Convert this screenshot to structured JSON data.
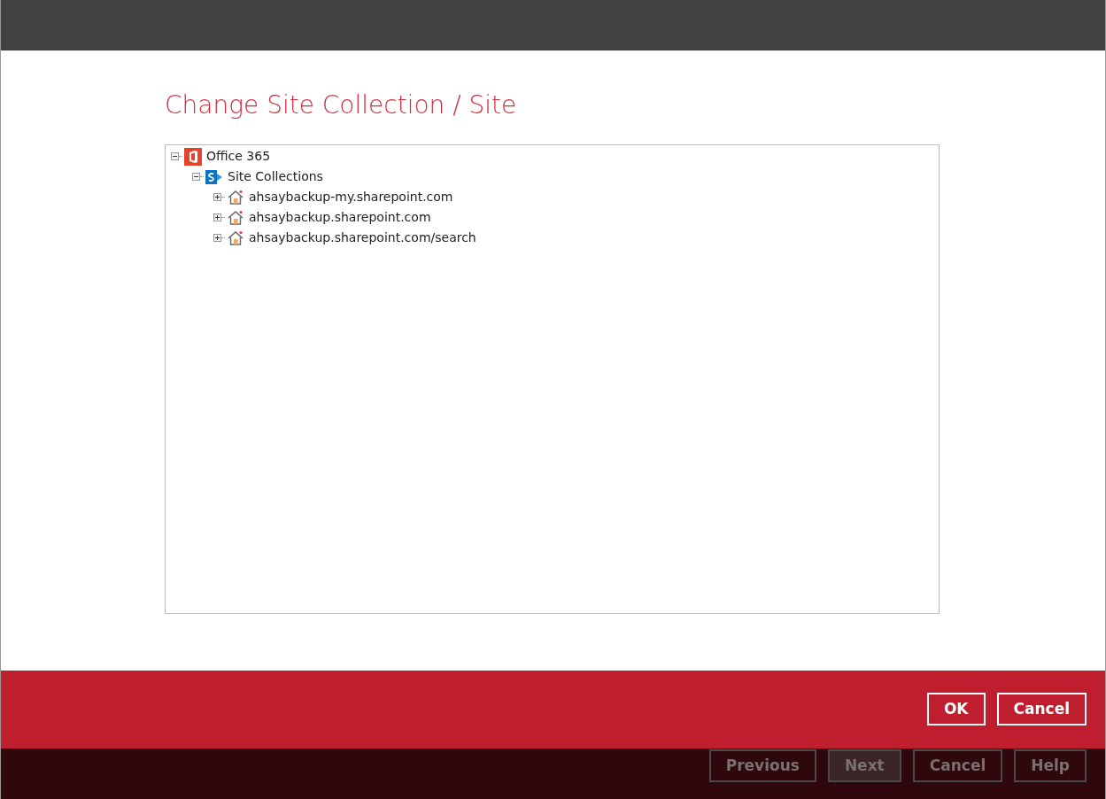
{
  "dialog": {
    "title": "Change Site Collection / Site"
  },
  "tree": [
    {
      "label": "Office 365",
      "kind": "office",
      "expanded": true,
      "children": [
        {
          "label": "Site Collections",
          "kind": "sharepoint",
          "expanded": true,
          "children": [
            {
              "label": "ahsaybackup-my.sharepoint.com",
              "kind": "site",
              "expanded": false
            },
            {
              "label": "ahsaybackup.sharepoint.com",
              "kind": "site",
              "expanded": false
            },
            {
              "label": "ahsaybackup.sharepoint.com/search",
              "kind": "site",
              "expanded": false
            }
          ]
        }
      ]
    }
  ],
  "dialog_buttons": [
    "OK",
    "Cancel"
  ],
  "background_buttons": [
    {
      "label": "Previous",
      "disabled": false
    },
    {
      "label": "Next",
      "disabled": true
    },
    {
      "label": "Cancel",
      "disabled": false
    },
    {
      "label": "Help",
      "disabled": false
    }
  ]
}
